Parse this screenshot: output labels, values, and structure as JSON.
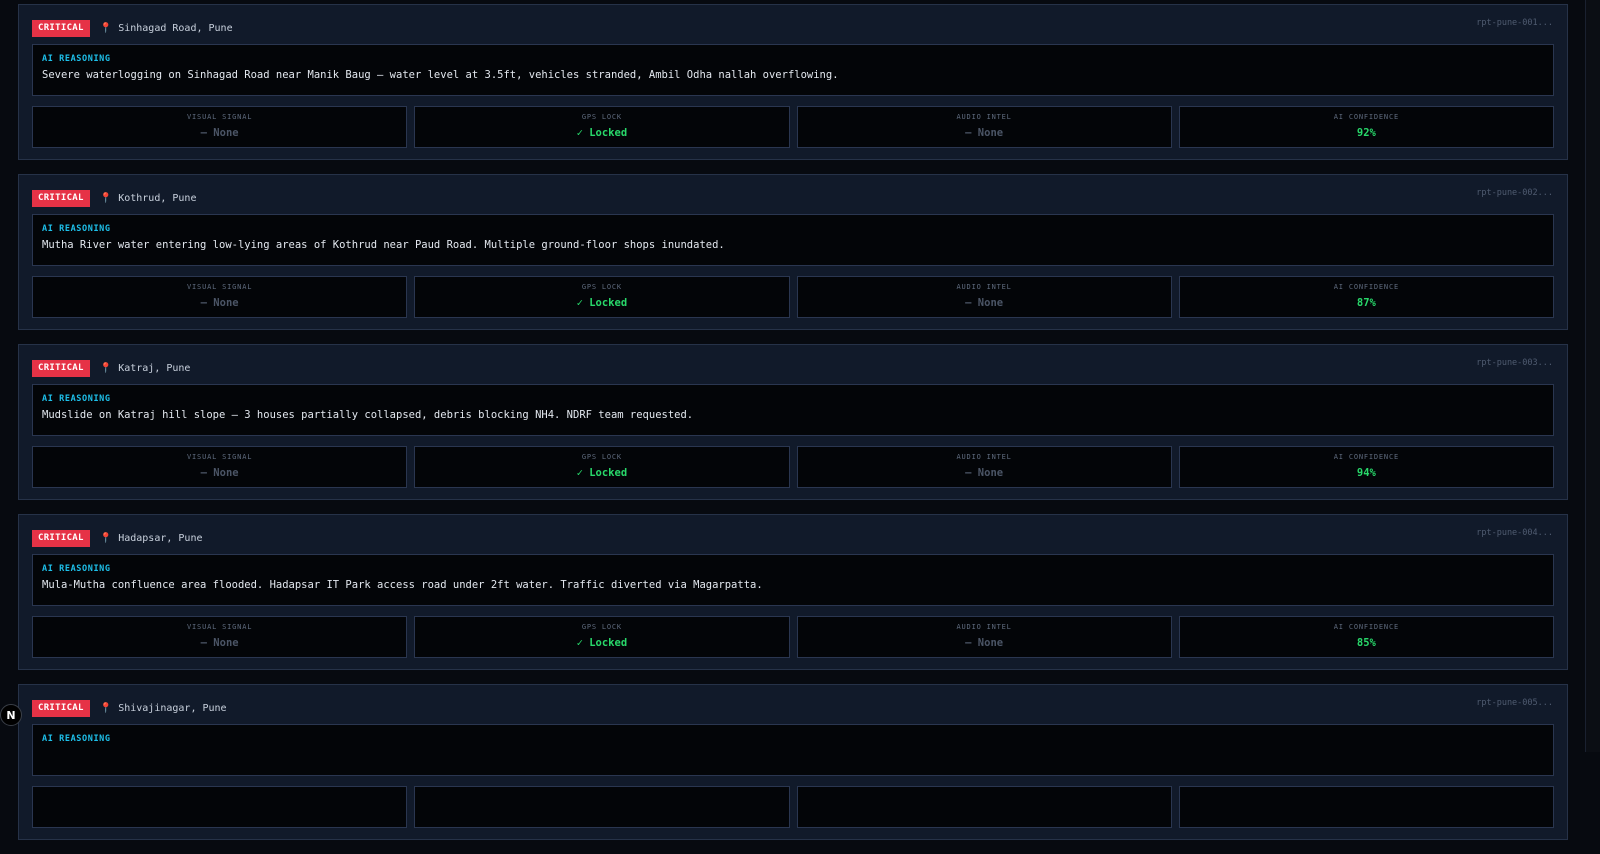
{
  "reports": [
    {
      "severity": "CRITICAL",
      "location": "Sinhagad Road, Pune",
      "id": "rpt-pune-001...",
      "reasoning_label": "AI REASONING",
      "reasoning": "Severe waterlogging on Sinhagad Road near Manik Baug — water level at 3.5ft, vehicles stranded, Ambil Odha nallah overflowing.",
      "visual_label": "VISUAL SIGNAL",
      "visual_value": "— None",
      "gps_label": "GPS LOCK",
      "gps_value": "✓ Locked",
      "audio_label": "AUDIO INTEL",
      "audio_value": "— None",
      "conf_label": "AI CONFIDENCE",
      "conf_value": "92%"
    },
    {
      "severity": "CRITICAL",
      "location": "Kothrud, Pune",
      "id": "rpt-pune-002...",
      "reasoning_label": "AI REASONING",
      "reasoning": "Mutha River water entering low-lying areas of Kothrud near Paud Road. Multiple ground-floor shops inundated.",
      "visual_label": "VISUAL SIGNAL",
      "visual_value": "— None",
      "gps_label": "GPS LOCK",
      "gps_value": "✓ Locked",
      "audio_label": "AUDIO INTEL",
      "audio_value": "— None",
      "conf_label": "AI CONFIDENCE",
      "conf_value": "87%"
    },
    {
      "severity": "CRITICAL",
      "location": "Katraj, Pune",
      "id": "rpt-pune-003...",
      "reasoning_label": "AI REASONING",
      "reasoning": "Mudslide on Katraj hill slope — 3 houses partially collapsed, debris blocking NH4. NDRF team requested.",
      "visual_label": "VISUAL SIGNAL",
      "visual_value": "— None",
      "gps_label": "GPS LOCK",
      "gps_value": "✓ Locked",
      "audio_label": "AUDIO INTEL",
      "audio_value": "— None",
      "conf_label": "AI CONFIDENCE",
      "conf_value": "94%"
    },
    {
      "severity": "CRITICAL",
      "location": "Hadapsar, Pune",
      "id": "rpt-pune-004...",
      "reasoning_label": "AI REASONING",
      "reasoning": "Mula-Mutha confluence area flooded. Hadapsar IT Park access road under 2ft water. Traffic diverted via Magarpatta.",
      "visual_label": "VISUAL SIGNAL",
      "visual_value": "— None",
      "gps_label": "GPS LOCK",
      "gps_value": "✓ Locked",
      "audio_label": "AUDIO INTEL",
      "audio_value": "— None",
      "conf_label": "AI CONFIDENCE",
      "conf_value": "85%"
    },
    {
      "severity": "CRITICAL",
      "location": "Shivajinagar, Pune",
      "id": "rpt-pune-005...",
      "reasoning_label": "AI REASONING",
      "reasoning": "",
      "visual_label": "",
      "visual_value": "",
      "gps_label": "",
      "gps_value": "",
      "audio_label": "",
      "audio_value": "",
      "conf_label": "",
      "conf_value": ""
    }
  ],
  "dev_badge": "N",
  "colors": {
    "critical": "#e63246",
    "accent": "#1ec0ea",
    "ok": "#28d86a",
    "pin": "#ff4d6d"
  },
  "icons": {
    "pin": "map-pin-icon",
    "check": "check-icon"
  }
}
